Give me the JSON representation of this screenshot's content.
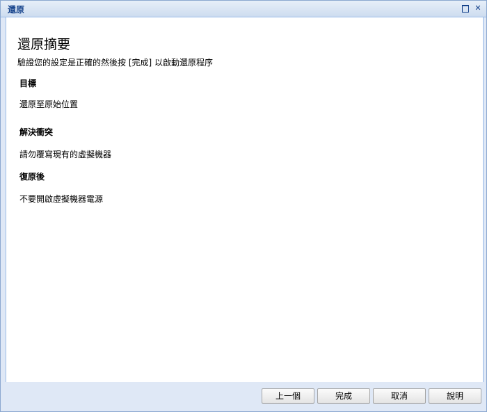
{
  "window": {
    "title": "還原"
  },
  "summary": {
    "heading": "還原摘要",
    "description": "驗證您的設定是正確的然後按 [完成] 以啟動還原程序",
    "sections": [
      {
        "label": "目標",
        "value": "還原至原始位置"
      },
      {
        "label": "解決衝突",
        "value": "請勿覆寫現有的虛擬機器"
      },
      {
        "label": "復原後",
        "value": "不要開啟虛擬機器電源"
      }
    ]
  },
  "buttons": {
    "previous": "上一個",
    "finish": "完成",
    "cancel": "取消",
    "help": "說明"
  },
  "icons": {
    "maximize": "maximize-icon",
    "close": "close-icon"
  },
  "colors": {
    "title_text": "#15428b",
    "frame_bg": "#dfe8f6",
    "frame_border": "#99bbe8"
  }
}
